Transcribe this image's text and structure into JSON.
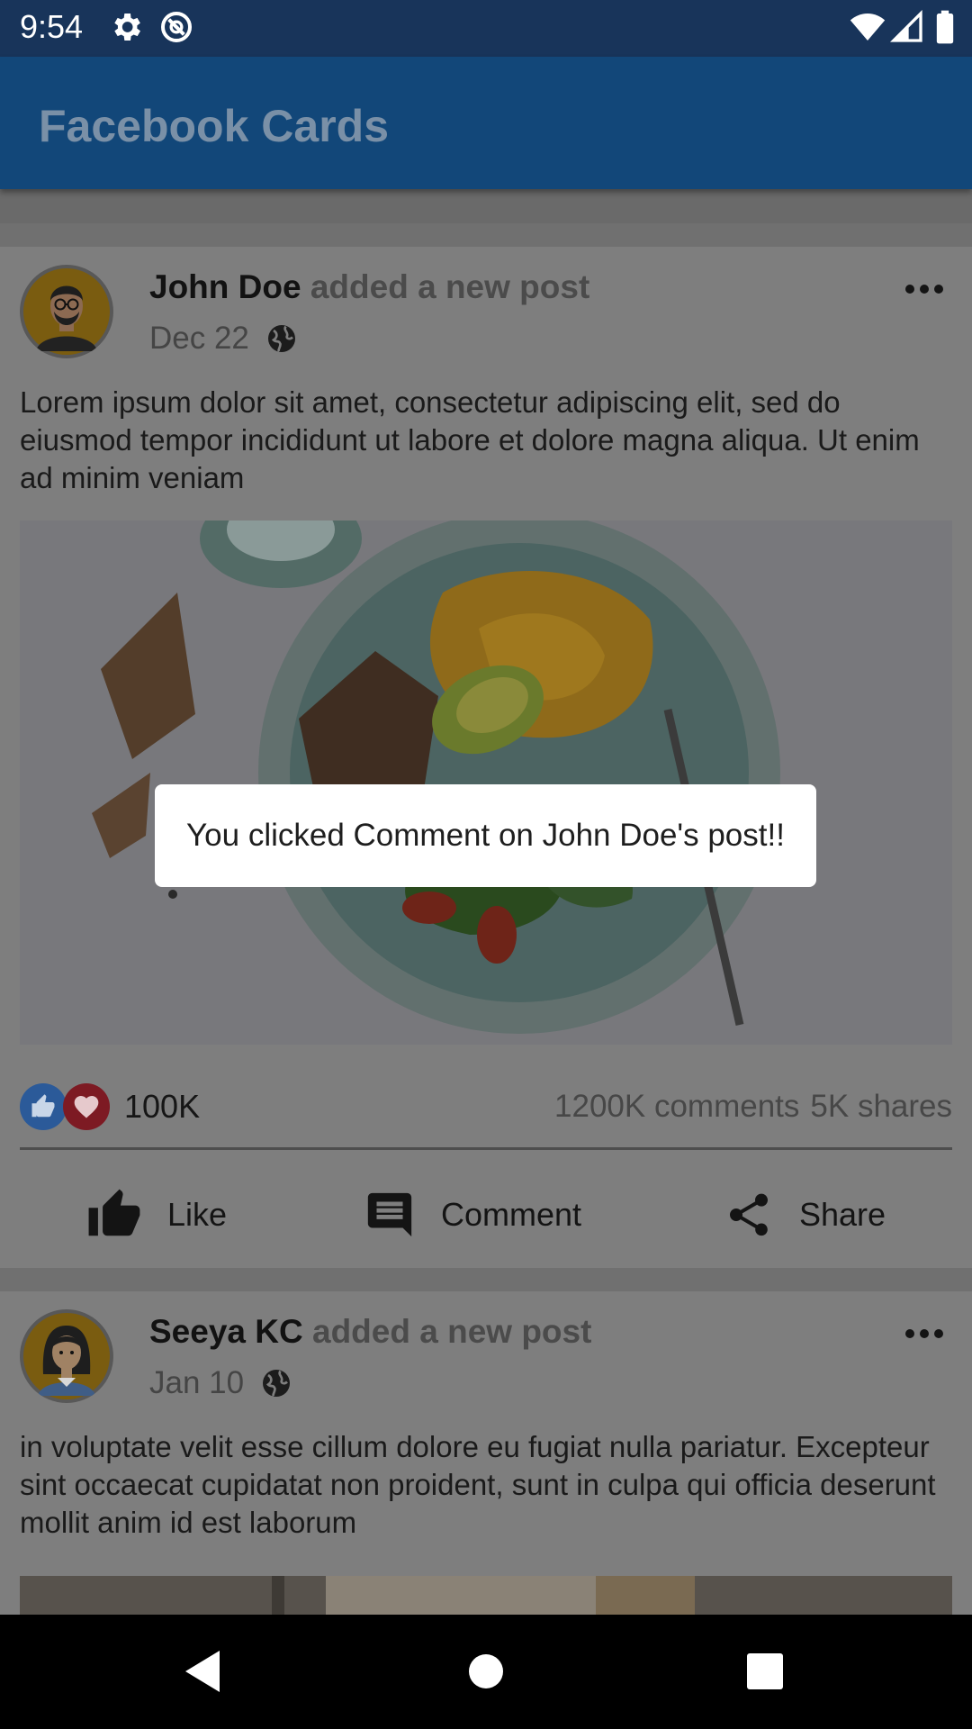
{
  "status_bar": {
    "time": "9:54",
    "icons": [
      "gear-icon",
      "data-saver-icon",
      "wifi-icon",
      "signal-icon",
      "battery-icon"
    ]
  },
  "app_bar": {
    "title": "Facebook Cards"
  },
  "posts": [
    {
      "name": "John Doe",
      "action": "added a new post",
      "date": "Dec 22",
      "text": "Lorem ipsum dolor sit amet, consectetur adipiscing elit, sed do eiusmod tempor incididunt ut labore et dolore magna aliqua. Ut enim ad minim veniam",
      "likes": "100K",
      "comments": "1200K comments",
      "shares": "5K shares"
    },
    {
      "name": "Seeya KC",
      "action": "added a new post",
      "date": "Jan 10",
      "text": "in voluptate velit esse cillum dolore eu fugiat nulla pariatur. Excepteur sint occaecat cupidatat non proident, sunt in culpa qui officia deserunt mollit anim id est laborum"
    }
  ],
  "actions": {
    "like": "Like",
    "comment": "Comment",
    "share": "Share"
  },
  "toast": {
    "message": "You clicked Comment on John Doe's post!!"
  },
  "colors": {
    "app_bar": "#124779",
    "status_bar": "#18345a",
    "like_badge": "#2b5a99",
    "love_badge": "#7d1a23"
  }
}
